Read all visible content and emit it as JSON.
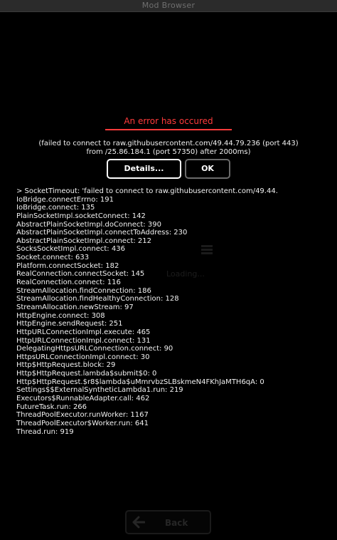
{
  "window": {
    "title": "Mod Browser"
  },
  "background": {
    "loading_text": "Loading...",
    "back_label": "Back"
  },
  "dialog": {
    "heading": "An error has occured",
    "message_line1": "(failed to connect to raw.githubusercontent.com/49.44.79.236 (port 443)",
    "message_line2": "from /25.86.184.1 (port 57350) after 2000ms)",
    "details_label": "Details...",
    "ok_label": "OK",
    "stacktrace": [
      "> SocketTimeout: 'failed to connect to raw.githubusercontent.com/49.44.",
      "IoBridge.connectErrno: 191",
      "IoBridge.connect: 135",
      "PlainSocketImpl.socketConnect: 142",
      "AbstractPlainSocketImpl.doConnect: 390",
      "AbstractPlainSocketImpl.connectToAddress: 230",
      "AbstractPlainSocketImpl.connect: 212",
      "SocksSocketImpl.connect: 436",
      "Socket.connect: 633",
      "Platform.connectSocket: 182",
      "RealConnection.connectSocket: 145",
      "RealConnection.connect: 116",
      "StreamAllocation.findConnection: 186",
      "StreamAllocation.findHealthyConnection: 128",
      "StreamAllocation.newStream: 97",
      "HttpEngine.connect: 308",
      "HttpEngine.sendRequest: 251",
      "HttpURLConnectionImpl.execute: 465",
      "HttpURLConnectionImpl.connect: 131",
      "DelegatingHttpsURLConnection.connect: 90",
      "HttpsURLConnectionImpl.connect: 30",
      "Http$HttpRequest.block: 29",
      "Http$HttpRequest.lambda$submit$0: 0",
      "Http$HttpRequest.$r8$lambda$uMmrvbzSLBskmeN4FKhJaMTH6qA: 0",
      "Settings$$ExternalSyntheticLambda1.run: 219",
      "Executors$RunnableAdapter.call: 462",
      "FutureTask.run: 266",
      "ThreadPoolExecutor.runWorker: 1167",
      "ThreadPoolExecutor$Worker.run: 641",
      "Thread.run: 919"
    ]
  },
  "colors": {
    "error_red": "#ff3b3b",
    "background": "#000000",
    "titlebar": "#2b2b2b",
    "text": "#f2f2f2"
  },
  "icons": {
    "loading": "list-icon",
    "back": "arrow-left-icon"
  }
}
